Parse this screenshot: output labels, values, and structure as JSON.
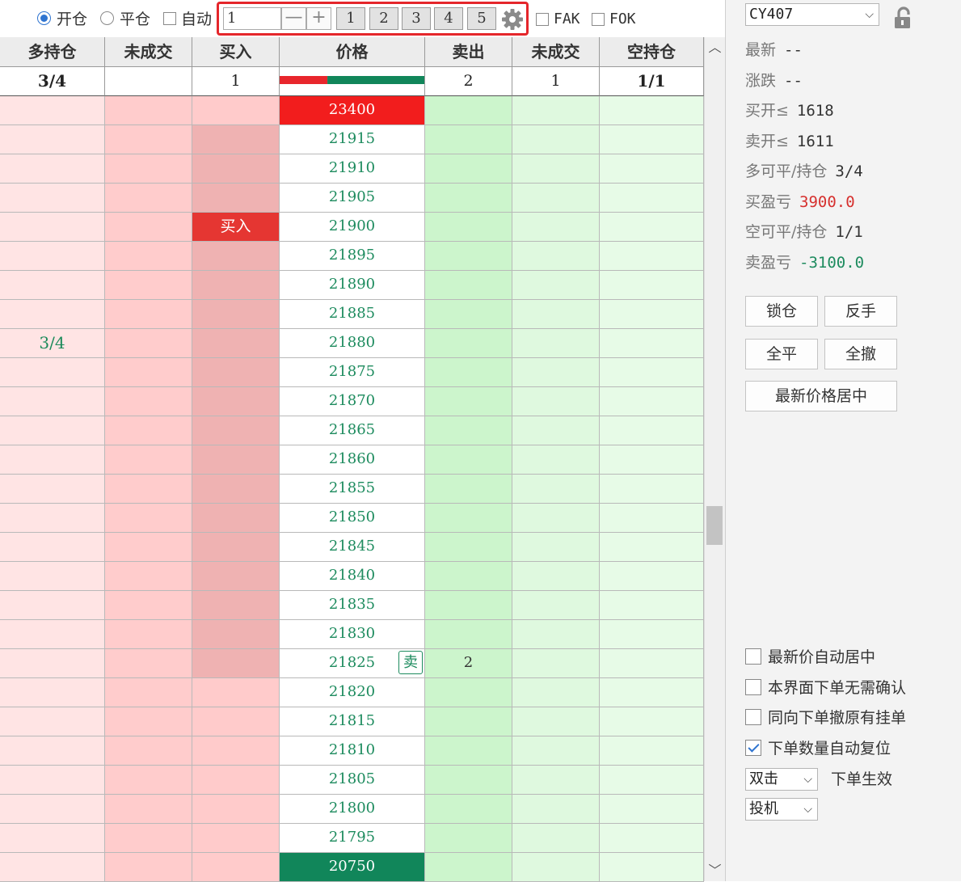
{
  "toolbar": {
    "open_label": "开仓",
    "close_label": "平仓",
    "auto_label": "自动",
    "quantity_value": "1",
    "minus_symbol": "—",
    "plus_symbol": "+",
    "quick_quantities": [
      "1",
      "2",
      "3",
      "4",
      "5"
    ],
    "settings_icon": "gear-icon",
    "fak_label": "FAK",
    "fok_label": "FOK",
    "selected_mode": "开仓",
    "highlight_color": "#e5262b"
  },
  "ladder": {
    "headers": [
      "多持仓",
      "未成交",
      "买入",
      "价格",
      "卖出",
      "未成交",
      "空持仓"
    ],
    "summary": {
      "long_position": "3/4",
      "long_pending": "",
      "buy": "1",
      "sell": "2",
      "short_pending": "1",
      "short_position": "1/1"
    },
    "bid_ask_ratio": {
      "bid_fraction": 0.33,
      "bid_color": "#e8262c",
      "ask_color": "#11865a"
    },
    "rows": [
      {
        "price": "23400",
        "style": "top"
      },
      {
        "price": "21915"
      },
      {
        "price": "21910"
      },
      {
        "price": "21905"
      },
      {
        "price": "21900",
        "buy": "买入",
        "buy_mark": true
      },
      {
        "price": "21895"
      },
      {
        "price": "21890"
      },
      {
        "price": "21885"
      },
      {
        "price": "21880",
        "long": "3/4"
      },
      {
        "price": "21875"
      },
      {
        "price": "21870"
      },
      {
        "price": "21865"
      },
      {
        "price": "21860"
      },
      {
        "price": "21855"
      },
      {
        "price": "21850"
      },
      {
        "price": "21845"
      },
      {
        "price": "21840"
      },
      {
        "price": "21835"
      },
      {
        "price": "21830"
      },
      {
        "price": "21825",
        "sell": "2",
        "sell_tag": "卖"
      },
      {
        "price": "21820"
      },
      {
        "price": "21815"
      },
      {
        "price": "21810"
      },
      {
        "price": "21805"
      },
      {
        "price": "21800"
      },
      {
        "price": "21795"
      },
      {
        "price": "20750",
        "style": "bot"
      }
    ],
    "buy_depth_rows": [
      1,
      19
    ]
  },
  "side": {
    "contract": "CY407",
    "lock_icon": "unlock-icon",
    "info": [
      {
        "label": "最新",
        "value": "--"
      },
      {
        "label": "涨跌",
        "value": "--"
      },
      {
        "label": "买开≤",
        "value": "1618"
      },
      {
        "label": "卖开≤",
        "value": "1611"
      },
      {
        "label": "多可平/持仓",
        "value": "3/4"
      },
      {
        "label": "买盈亏",
        "value": "3900.0",
        "tone": "red"
      },
      {
        "label": "空可平/持仓",
        "value": "1/1"
      },
      {
        "label": "卖盈亏",
        "value": "-3100.0",
        "tone": "green"
      }
    ],
    "buttons": {
      "lock": "锁仓",
      "reverse": "反手",
      "close_all": "全平",
      "cancel_all": "全撤",
      "center": "最新价格居中"
    },
    "options": [
      {
        "label": "最新价自动居中",
        "checked": false
      },
      {
        "label": "本界面下单无需确认",
        "checked": false
      },
      {
        "label": "同向下单撤原有挂单",
        "checked": false
      },
      {
        "label": "下单数量自动复位",
        "checked": true
      }
    ],
    "click_mode": "双击",
    "click_mode_suffix": "下单生效",
    "hedge_mode": "投机"
  }
}
